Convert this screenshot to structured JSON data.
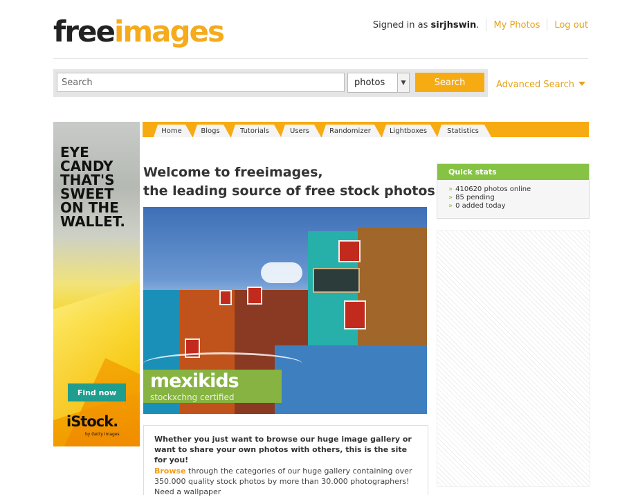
{
  "header": {
    "logo_free": "free",
    "logo_images": "images",
    "signed_in_prefix": "Signed in as",
    "username": "sirjhswin",
    "username_suffix": ".",
    "my_photos": "My Photos",
    "log_out": "Log out"
  },
  "search": {
    "placeholder": "Search",
    "type_value": "photos",
    "button": "Search",
    "advanced": "Advanced Search"
  },
  "ad": {
    "headline": "EYE\nCANDY\nTHAT'S\nSWEET\nON THE\nWALLET.",
    "cta": "Find now",
    "brand": "iStock.",
    "brand_sub": "by Getty Images"
  },
  "tabs": [
    "Home",
    "Blogs",
    "Tutorials",
    "Users",
    "Randomizer",
    "Lightboxes",
    "Statistics"
  ],
  "main": {
    "welcome_line1": "Welcome to freeimages,",
    "welcome_line2": "the leading source of free stock photos!",
    "featured_title": "mexikids",
    "featured_sub": "stockxchng certified",
    "intro": "Whether you just want to browse our huge image gallery or want to share your own photos with others, this is the site for you!",
    "browse_link": "Browse",
    "browse_text": " through the categories of our huge gallery containing over 350.000 quality stock photos by more than 30.000 photographers! Need a wallpaper"
  },
  "quick_stats": {
    "title": "Quick stats",
    "items": [
      "410620 photos online",
      "85 pending",
      "0 added today"
    ]
  },
  "colors": {
    "accent": "#f7ab13",
    "green": "#86c345",
    "link": "#e5a21a"
  }
}
